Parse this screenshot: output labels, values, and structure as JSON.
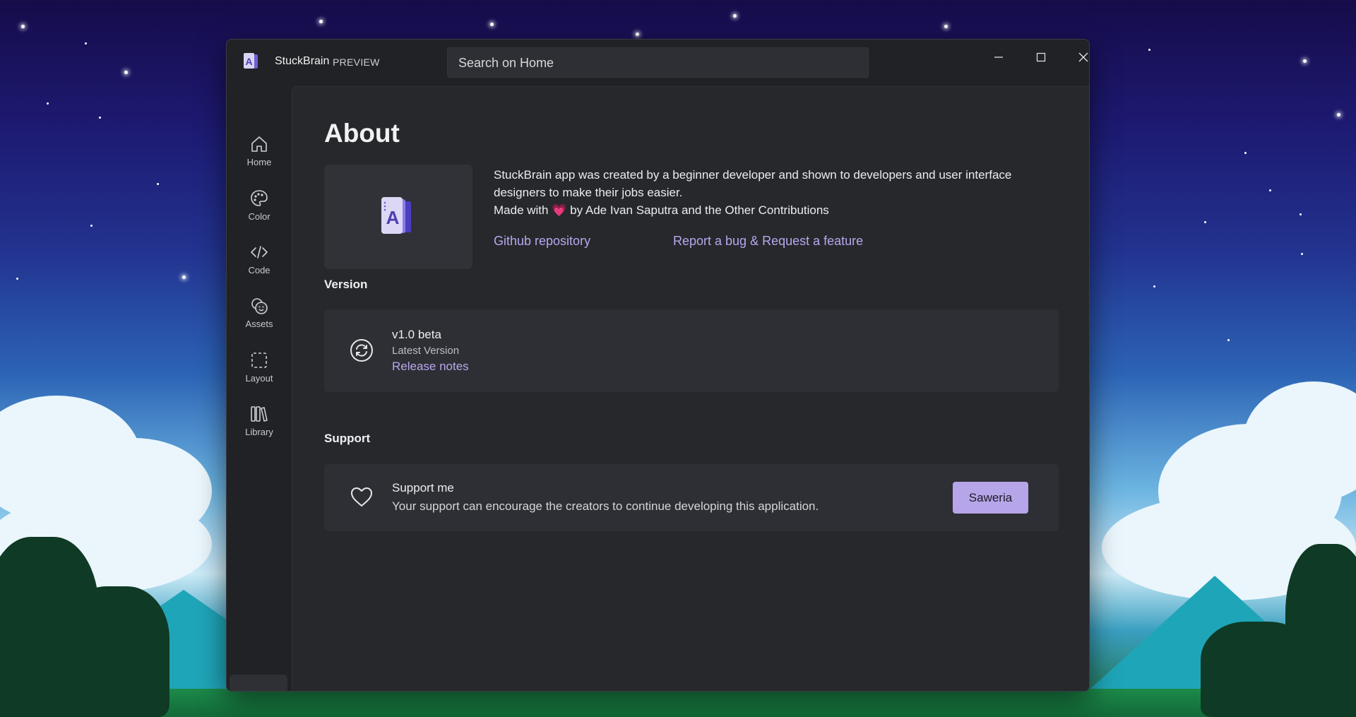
{
  "app": {
    "name": "StuckBrain",
    "tag": "PREVIEW"
  },
  "search": {
    "placeholder": "Search on Home"
  },
  "sidebar": {
    "items": [
      {
        "label": "Home",
        "icon": "home-icon"
      },
      {
        "label": "Color",
        "icon": "palette-icon"
      },
      {
        "label": "Code",
        "icon": "code-icon"
      },
      {
        "label": "Assets",
        "icon": "emoji-icon"
      },
      {
        "label": "Layout",
        "icon": "dashed-square-icon"
      },
      {
        "label": "Library",
        "icon": "library-icon"
      }
    ],
    "active_icon": "info-icon"
  },
  "about": {
    "title": "About",
    "description_line1": "StuckBrain app was created by a beginner developer and shown to developers and user interface designers to make their jobs easier.",
    "made_with_prefix": "Made with",
    "made_with_emoji": "💗",
    "made_with_suffix": "by Ade Ivan Saputra and the Other Contributions",
    "link_github": "Github repository",
    "link_bug": "Report a bug & Request a feature"
  },
  "version": {
    "section_title": "Version",
    "number": "v1.0 beta",
    "status": "Latest Version",
    "release_notes": "Release notes"
  },
  "support": {
    "section_title": "Support",
    "title": "Support me",
    "description": "Your support can encourage the creators to continue developing this application.",
    "button": "Saweria"
  },
  "colors": {
    "accent": "#b6a5e8",
    "window_bg": "#202226",
    "content_bg": "#26282c",
    "card_bg": "#2d2f34"
  }
}
